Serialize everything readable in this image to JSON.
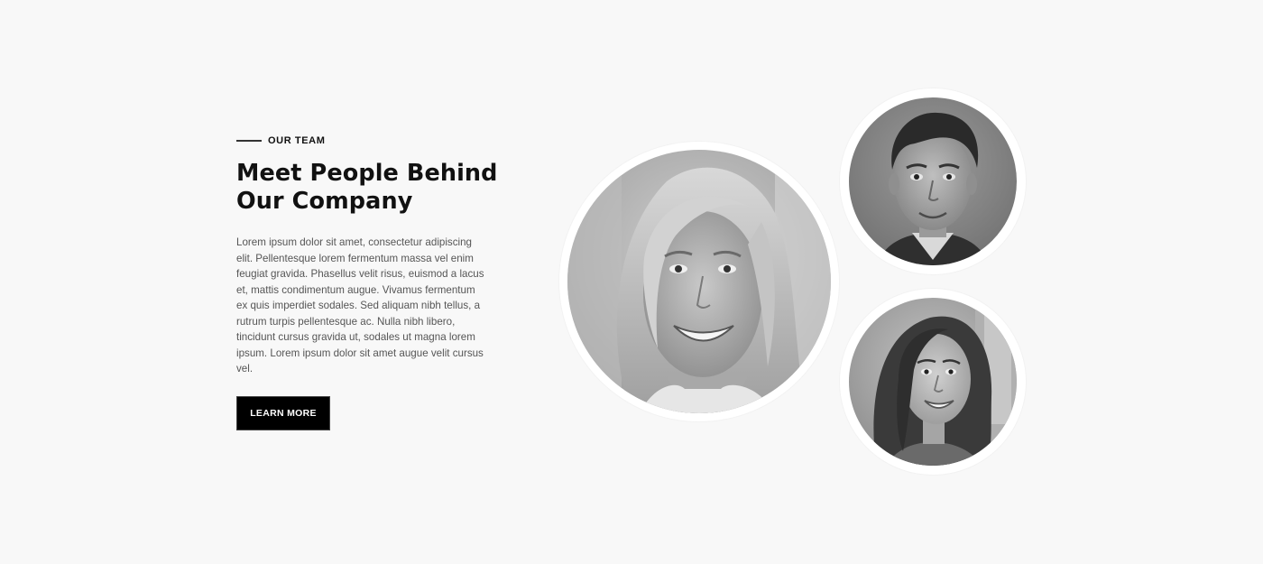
{
  "section": {
    "eyebrow": "OUR TEAM",
    "heading_line1": "Meet People Behind",
    "heading_line2": "Our Company",
    "body_lines": [
      "Lorem ipsum dolor sit amet, consectetur adipiscing",
      "elit. Pellentesque lorem fermentum massa vel enim",
      "feugiat gravida. Phasellus velit risus, euismod a lacus",
      "et, mattis condimentum augue. Vivamus fermentum",
      "ex quis imperdiet sodales. Sed aliquam nibh tellus, a",
      "rutrum turpis pellentesque ac. Nulla nibh libero,",
      "tincidunt cursus gravida ut, sodales ut magna lorem",
      "ipsum. Lorem ipsum dolor sit amet augue velit cursus",
      "vel."
    ],
    "button_label": "LEARN MORE"
  },
  "team_photos": [
    {
      "name": "team-photo-woman-blonde",
      "style": "grayscale"
    },
    {
      "name": "team-photo-man",
      "style": "grayscale"
    },
    {
      "name": "team-photo-woman-brunette",
      "style": "grayscale"
    }
  ],
  "colors": {
    "background": "#f8f8f8",
    "text": "#111111",
    "body_text": "#555555",
    "button_bg": "#000000",
    "button_text": "#ffffff"
  }
}
